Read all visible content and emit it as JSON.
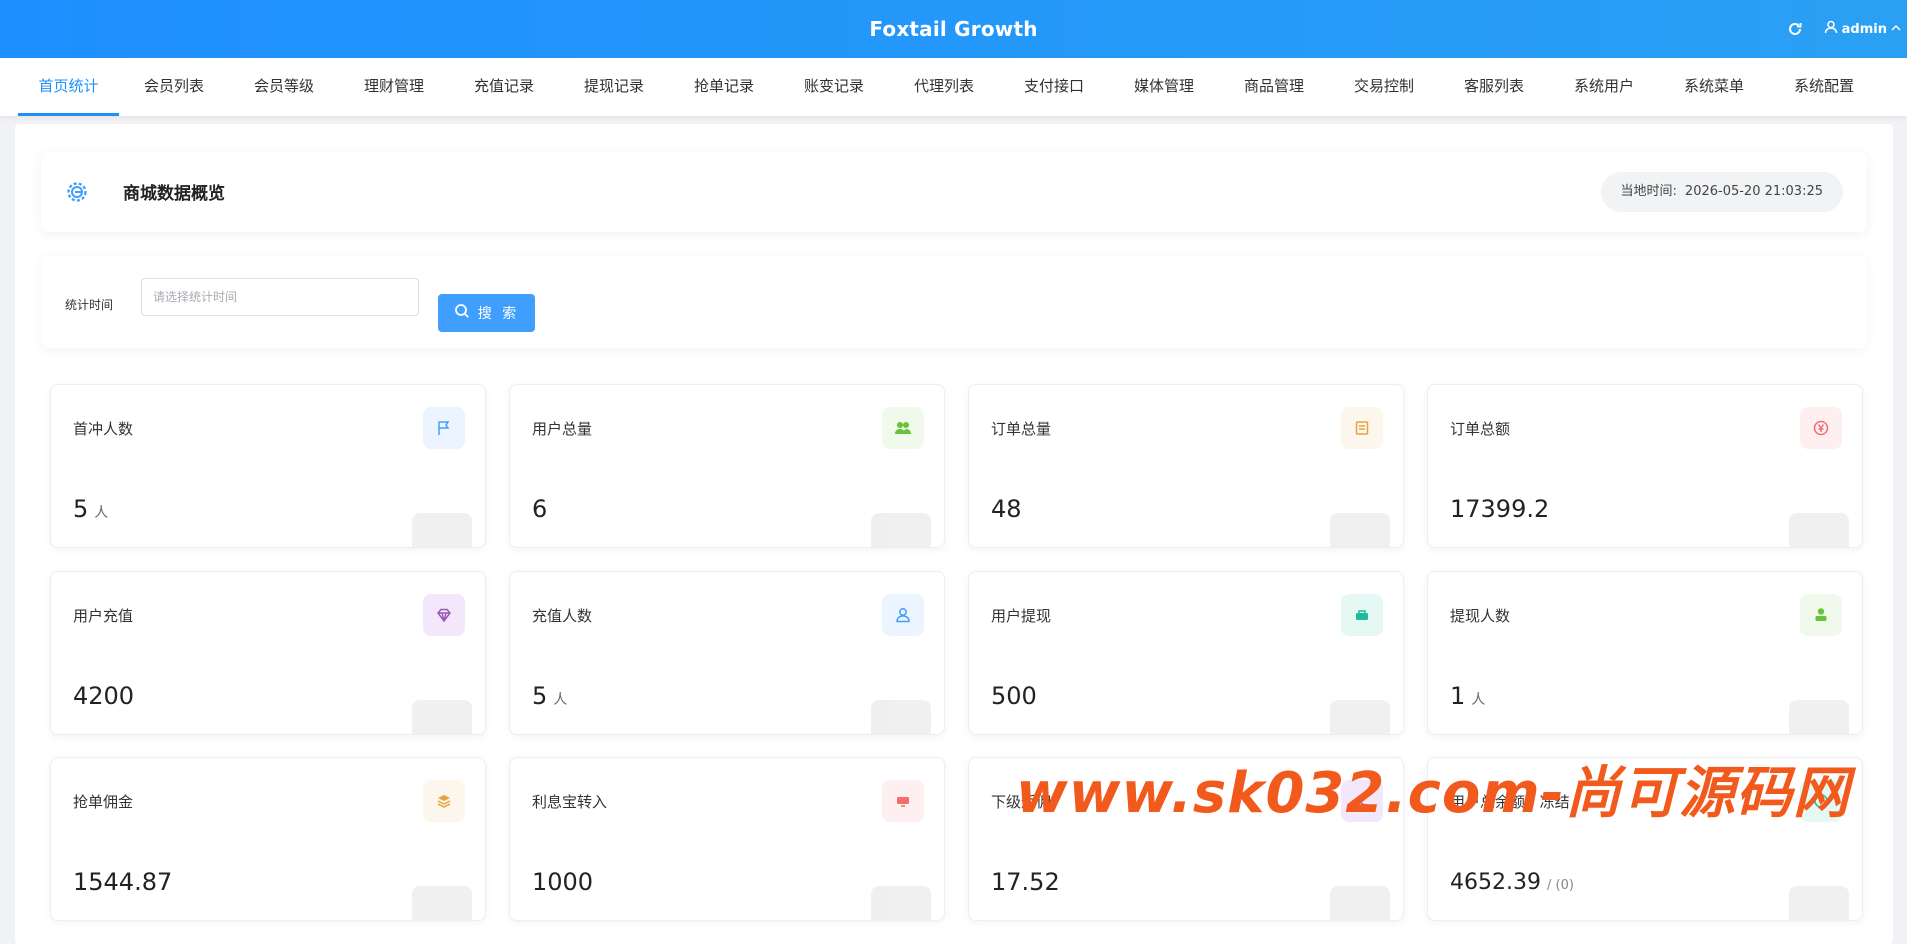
{
  "header": {
    "title": "Foxtail Growth",
    "user": "admin"
  },
  "nav": {
    "items": [
      "首页统计",
      "会员列表",
      "会员等级",
      "理财管理",
      "充值记录",
      "提现记录",
      "抢单记录",
      "账变记录",
      "代理列表",
      "支付接口",
      "媒体管理",
      "商品管理",
      "交易控制",
      "客服列表",
      "系统用户",
      "系统菜单",
      "系统配置"
    ],
    "active": "首页统计"
  },
  "overview": {
    "title": "商城数据概览",
    "time_label": "当地时间:",
    "time_value": "2026-05-20 21:03:25"
  },
  "filter": {
    "label": "统计时间",
    "placeholder": "请选择统计时间",
    "value": "",
    "search_label": "搜 索"
  },
  "stats": [
    {
      "label": "首冲人数",
      "value": "5",
      "unit": "人",
      "icon": "flag-icon",
      "color": "#409eff",
      "bg": "#ecf5ff"
    },
    {
      "label": "用户总量",
      "value": "6",
      "unit": "",
      "icon": "users-icon",
      "color": "#67c23a",
      "bg": "#f0f9eb"
    },
    {
      "label": "订单总量",
      "value": "48",
      "unit": "",
      "icon": "document-icon",
      "color": "#e6a23c",
      "bg": "#fdf6ec"
    },
    {
      "label": "订单总额",
      "value": "17399.2",
      "unit": "",
      "icon": "yen-icon",
      "color": "#f56c6c",
      "bg": "#fef0f0"
    },
    {
      "label": "用户充值",
      "value": "4200",
      "unit": "",
      "icon": "diamond-icon",
      "color": "#9b59b6",
      "bg": "#f3e8fb"
    },
    {
      "label": "充值人数",
      "value": "5",
      "unit": "人",
      "icon": "user-outline-icon",
      "color": "#409eff",
      "bg": "#ecf5ff"
    },
    {
      "label": "用户提现",
      "value": "500",
      "unit": "",
      "icon": "wallet-icon",
      "color": "#1abc9c",
      "bg": "#e6f8f3"
    },
    {
      "label": "提现人数",
      "value": "1",
      "unit": "人",
      "icon": "user-icon",
      "color": "#67c23a",
      "bg": "#f0f9eb"
    },
    {
      "label": "抢单佣金",
      "value": "1544.87",
      "unit": "",
      "icon": "layers-icon",
      "color": "#e6a23c",
      "bg": "#fdf6ec"
    },
    {
      "label": "利息宝转入",
      "value": "1000",
      "unit": "",
      "icon": "card-icon",
      "color": "#f56c6c",
      "bg": "#fef0f0"
    },
    {
      "label": "下级返佣",
      "value": "17.52",
      "unit": "",
      "icon": "share-icon",
      "color": "#9b59b6",
      "bg": "#f3e8fb"
    },
    {
      "label": "用户总余额 / 冻结",
      "value": "4652.39",
      "unit": "",
      "sub": "/ (0)",
      "icon": "coin-icon",
      "color": "#1abc9c",
      "bg": "#e6f8f3"
    }
  ],
  "watermark": "www.sk032.com-尚可源码网"
}
